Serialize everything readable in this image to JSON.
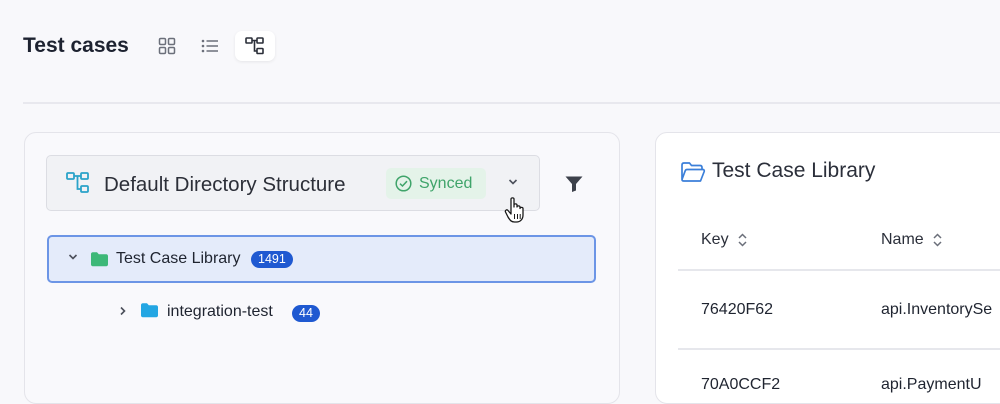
{
  "page": {
    "title": "Test cases"
  },
  "views": [
    {
      "name": "grid-view",
      "icon": "grid-icon",
      "active": false
    },
    {
      "name": "list-view",
      "icon": "list-icon",
      "active": false
    },
    {
      "name": "tree-view",
      "icon": "tree-structure-icon",
      "active": true
    }
  ],
  "directory": {
    "selector_label": "Default Directory Structure",
    "status": "Synced",
    "status_color": "#3fa46a",
    "accent": "#1f59d1"
  },
  "tree": [
    {
      "label": "Test Case Library",
      "count": "1491",
      "expanded": true,
      "selected": true
    },
    {
      "label": "integration-test",
      "count": "44",
      "expanded": false,
      "selected": false
    }
  ],
  "right_panel": {
    "title": "Test Case Library",
    "columns": [
      "Key",
      "Name"
    ],
    "rows": [
      {
        "key": "76420F62",
        "name": "api.InventorySe"
      },
      {
        "key": "70A0CCF2",
        "name": "api.PaymentU"
      }
    ]
  }
}
